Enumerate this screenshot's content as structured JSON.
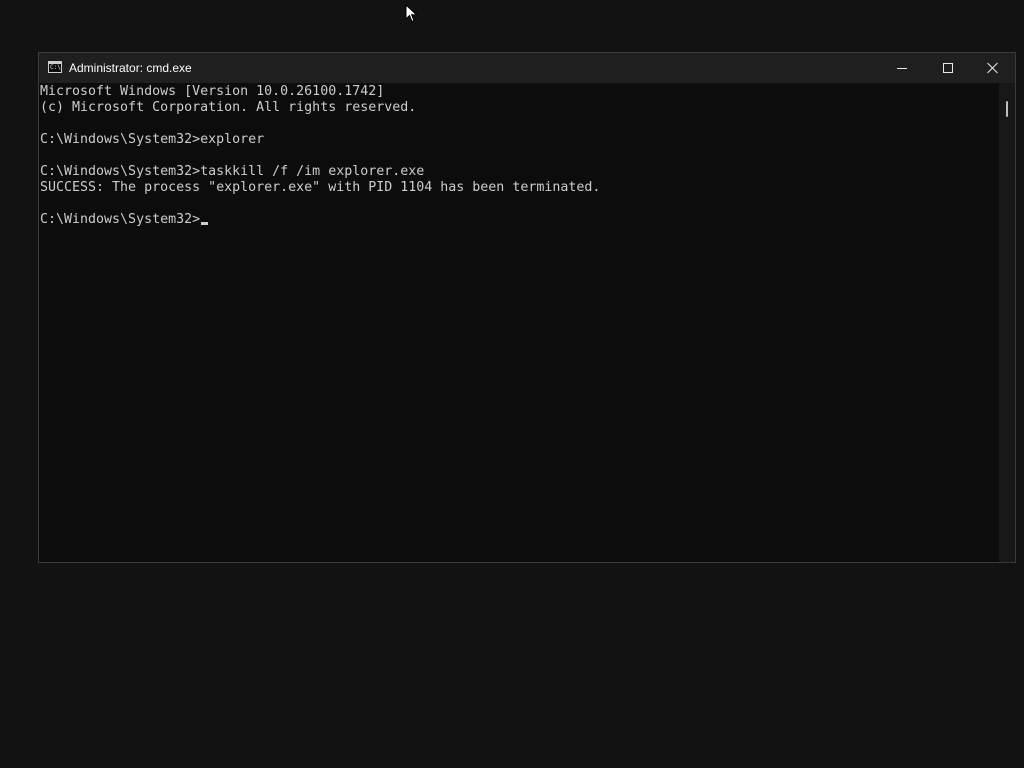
{
  "window": {
    "title": "Administrator: cmd.exe",
    "icon": "console-icon",
    "controls": {
      "minimize": "minimize-icon",
      "maximize": "maximize-icon",
      "close": "close-icon"
    }
  },
  "console": {
    "lines": [
      "Microsoft Windows [Version 10.0.26100.1742]",
      "(c) Microsoft Corporation. All rights reserved.",
      "",
      "C:\\Windows\\System32>explorer",
      "",
      "C:\\Windows\\System32>taskkill /f /im explorer.exe",
      "SUCCESS: The process \"explorer.exe\" with PID 1104 has been terminated.",
      "",
      "C:\\Windows\\System32>"
    ],
    "colors": {
      "background": "#0c0c0c",
      "foreground": "#cccccc",
      "titlebar": "#1f1f1f",
      "desktop": "#121212"
    }
  },
  "icons": {
    "app_icon_text": "C:\\",
    "pointer": "mouse-pointer-icon"
  }
}
